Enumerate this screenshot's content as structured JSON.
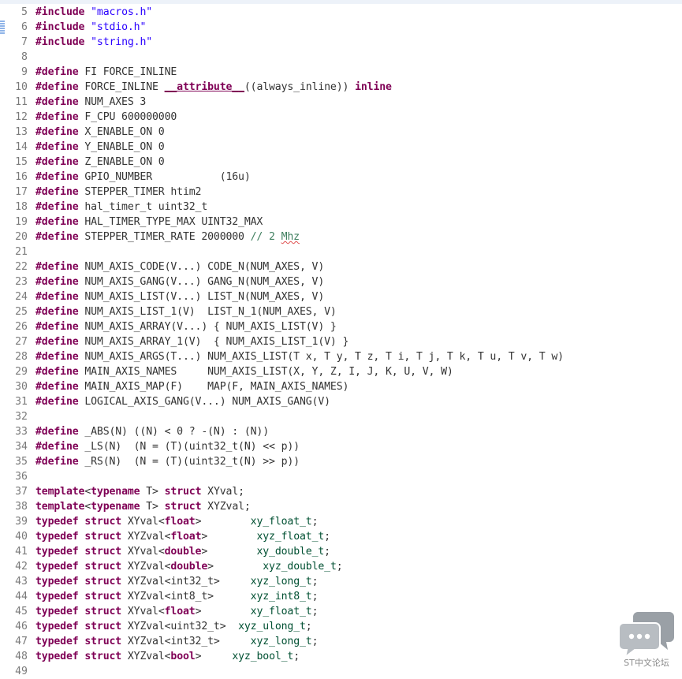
{
  "editor": {
    "lines": [
      {
        "n": "5",
        "tokens": [
          {
            "t": "#include",
            "c": "kw"
          },
          {
            "t": " ",
            "c": ""
          },
          {
            "t": "\"macros.h\"",
            "c": "str"
          }
        ]
      },
      {
        "n": "6",
        "tokens": [
          {
            "t": "#include",
            "c": "kw"
          },
          {
            "t": " ",
            "c": ""
          },
          {
            "t": "\"stdio.h\"",
            "c": "str"
          }
        ]
      },
      {
        "n": "7",
        "tokens": [
          {
            "t": "#include",
            "c": "kw"
          },
          {
            "t": " ",
            "c": ""
          },
          {
            "t": "\"string.h\"",
            "c": "str"
          }
        ]
      },
      {
        "n": "8",
        "tokens": []
      },
      {
        "n": "9",
        "tokens": [
          {
            "t": "#define",
            "c": "kw"
          },
          {
            "t": " FI FORCE_INLINE",
            "c": ""
          }
        ]
      },
      {
        "n": "10",
        "tokens": [
          {
            "t": "#define",
            "c": "kw"
          },
          {
            "t": " FORCE_INLINE ",
            "c": ""
          },
          {
            "t": "__attribute__",
            "c": "tm"
          },
          {
            "t": "((always_inline)) ",
            "c": ""
          },
          {
            "t": "inline",
            "c": "kw"
          }
        ]
      },
      {
        "n": "11",
        "tokens": [
          {
            "t": "#define",
            "c": "kw"
          },
          {
            "t": " NUM_AXES 3",
            "c": ""
          }
        ]
      },
      {
        "n": "12",
        "tokens": [
          {
            "t": "#define",
            "c": "kw"
          },
          {
            "t": " F_CPU 600000000",
            "c": ""
          }
        ]
      },
      {
        "n": "13",
        "tokens": [
          {
            "t": "#define",
            "c": "kw"
          },
          {
            "t": " X_ENABLE_ON 0",
            "c": ""
          }
        ]
      },
      {
        "n": "14",
        "tokens": [
          {
            "t": "#define",
            "c": "kw"
          },
          {
            "t": " Y_ENABLE_ON 0",
            "c": ""
          }
        ]
      },
      {
        "n": "15",
        "tokens": [
          {
            "t": "#define",
            "c": "kw"
          },
          {
            "t": " Z_ENABLE_ON 0",
            "c": ""
          }
        ]
      },
      {
        "n": "16",
        "tokens": [
          {
            "t": "#define",
            "c": "kw"
          },
          {
            "t": " GPIO_NUMBER           (16u)",
            "c": ""
          }
        ]
      },
      {
        "n": "17",
        "tokens": [
          {
            "t": "#define",
            "c": "kw"
          },
          {
            "t": " STEPPER_TIMER htim2",
            "c": ""
          }
        ]
      },
      {
        "n": "18",
        "tokens": [
          {
            "t": "#define",
            "c": "kw"
          },
          {
            "t": " hal_timer_t uint32_t",
            "c": ""
          }
        ]
      },
      {
        "n": "19",
        "tokens": [
          {
            "t": "#define",
            "c": "kw"
          },
          {
            "t": " HAL_TIMER_TYPE_MAX UINT32_MAX",
            "c": ""
          }
        ]
      },
      {
        "n": "20",
        "tokens": [
          {
            "t": "#define",
            "c": "kw"
          },
          {
            "t": " STEPPER_TIMER_RATE 2000000 ",
            "c": ""
          },
          {
            "t": "// 2 ",
            "c": "cm"
          },
          {
            "t": "Mhz",
            "c": "cm sq"
          }
        ]
      },
      {
        "n": "21",
        "tokens": []
      },
      {
        "n": "22",
        "tokens": [
          {
            "t": "#define",
            "c": "kw"
          },
          {
            "t": " NUM_AXIS_CODE(V...) CODE_N(NUM_AXES, V)",
            "c": ""
          }
        ]
      },
      {
        "n": "23",
        "tokens": [
          {
            "t": "#define",
            "c": "kw"
          },
          {
            "t": " NUM_AXIS_GANG(V...) GANG_N(NUM_AXES, V)",
            "c": ""
          }
        ]
      },
      {
        "n": "24",
        "tokens": [
          {
            "t": "#define",
            "c": "kw"
          },
          {
            "t": " NUM_AXIS_LIST(V...) LIST_N(NUM_AXES, V)",
            "c": ""
          }
        ]
      },
      {
        "n": "25",
        "tokens": [
          {
            "t": "#define",
            "c": "kw"
          },
          {
            "t": " NUM_AXIS_LIST_1(V)  LIST_N_1(NUM_AXES, V)",
            "c": ""
          }
        ]
      },
      {
        "n": "26",
        "tokens": [
          {
            "t": "#define",
            "c": "kw"
          },
          {
            "t": " NUM_AXIS_ARRAY(V...) { NUM_AXIS_LIST(V) }",
            "c": ""
          }
        ]
      },
      {
        "n": "27",
        "tokens": [
          {
            "t": "#define",
            "c": "kw"
          },
          {
            "t": " NUM_AXIS_ARRAY_1(V)  { NUM_AXIS_LIST_1(V) }",
            "c": ""
          }
        ]
      },
      {
        "n": "28",
        "tokens": [
          {
            "t": "#define",
            "c": "kw"
          },
          {
            "t": " NUM_AXIS_ARGS(T...) NUM_AXIS_LIST(T x, T y, T z, T i, T j, T k, T u, T v, T w)",
            "c": ""
          }
        ]
      },
      {
        "n": "29",
        "tokens": [
          {
            "t": "#define",
            "c": "kw"
          },
          {
            "t": " MAIN_AXIS_NAMES     NUM_AXIS_LIST(X, Y, Z, I, J, K, U, V, W)",
            "c": ""
          }
        ]
      },
      {
        "n": "30",
        "tokens": [
          {
            "t": "#define",
            "c": "kw"
          },
          {
            "t": " MAIN_AXIS_MAP(F)    MAP(F, MAIN_AXIS_NAMES)",
            "c": ""
          }
        ]
      },
      {
        "n": "31",
        "tokens": [
          {
            "t": "#define",
            "c": "kw"
          },
          {
            "t": " LOGICAL_AXIS_GANG(V...) NUM_AXIS_GANG(V)",
            "c": ""
          }
        ]
      },
      {
        "n": "32",
        "tokens": []
      },
      {
        "n": "33",
        "tokens": [
          {
            "t": "#define",
            "c": "kw"
          },
          {
            "t": " _ABS(N) ((N) < 0 ? -(N) : (N))",
            "c": ""
          }
        ]
      },
      {
        "n": "34",
        "tokens": [
          {
            "t": "#define",
            "c": "kw"
          },
          {
            "t": " _LS(N)  (N = (T)(uint32_t(N) << p))",
            "c": ""
          }
        ]
      },
      {
        "n": "35",
        "tokens": [
          {
            "t": "#define",
            "c": "kw"
          },
          {
            "t": " _RS(N)  (N = (T)(uint32_t(N) >> p))",
            "c": ""
          }
        ]
      },
      {
        "n": "36",
        "tokens": []
      },
      {
        "n": "37",
        "tokens": [
          {
            "t": "template",
            "c": "kw"
          },
          {
            "t": "<",
            "c": ""
          },
          {
            "t": "typename",
            "c": "kw"
          },
          {
            "t": " T> ",
            "c": ""
          },
          {
            "t": "struct",
            "c": "kw"
          },
          {
            "t": " XYval;",
            "c": ""
          }
        ]
      },
      {
        "n": "38",
        "tokens": [
          {
            "t": "template",
            "c": "kw"
          },
          {
            "t": "<",
            "c": ""
          },
          {
            "t": "typename",
            "c": "kw"
          },
          {
            "t": " T> ",
            "c": ""
          },
          {
            "t": "struct",
            "c": "kw"
          },
          {
            "t": " XYZval;",
            "c": ""
          }
        ]
      },
      {
        "n": "39",
        "tokens": [
          {
            "t": "typedef",
            "c": "kw"
          },
          {
            "t": " ",
            "c": ""
          },
          {
            "t": "struct",
            "c": "kw"
          },
          {
            "t": " XYval<",
            "c": ""
          },
          {
            "t": "float",
            "c": "kw"
          },
          {
            "t": ">        ",
            "c": ""
          },
          {
            "t": "xy_float_t",
            "c": "ty"
          },
          {
            "t": ";",
            "c": ""
          }
        ]
      },
      {
        "n": "40",
        "tokens": [
          {
            "t": "typedef",
            "c": "kw"
          },
          {
            "t": " ",
            "c": ""
          },
          {
            "t": "struct",
            "c": "kw"
          },
          {
            "t": " XYZval<",
            "c": ""
          },
          {
            "t": "float",
            "c": "kw"
          },
          {
            "t": ">        ",
            "c": ""
          },
          {
            "t": "xyz_float_t",
            "c": "ty"
          },
          {
            "t": ";",
            "c": ""
          }
        ]
      },
      {
        "n": "41",
        "tokens": [
          {
            "t": "typedef",
            "c": "kw"
          },
          {
            "t": " ",
            "c": ""
          },
          {
            "t": "struct",
            "c": "kw"
          },
          {
            "t": " XYval<",
            "c": ""
          },
          {
            "t": "double",
            "c": "kw"
          },
          {
            "t": ">        ",
            "c": ""
          },
          {
            "t": "xy_double_t",
            "c": "ty"
          },
          {
            "t": ";",
            "c": ""
          }
        ]
      },
      {
        "n": "42",
        "tokens": [
          {
            "t": "typedef",
            "c": "kw"
          },
          {
            "t": " ",
            "c": ""
          },
          {
            "t": "struct",
            "c": "kw"
          },
          {
            "t": " XYZval<",
            "c": ""
          },
          {
            "t": "double",
            "c": "kw"
          },
          {
            "t": ">        ",
            "c": ""
          },
          {
            "t": "xyz_double_t",
            "c": "ty"
          },
          {
            "t": ";",
            "c": ""
          }
        ]
      },
      {
        "n": "43",
        "tokens": [
          {
            "t": "typedef",
            "c": "kw"
          },
          {
            "t": " ",
            "c": ""
          },
          {
            "t": "struct",
            "c": "kw"
          },
          {
            "t": " XYZval<int32_t>     ",
            "c": ""
          },
          {
            "t": "xyz_long_t",
            "c": "ty"
          },
          {
            "t": ";",
            "c": ""
          }
        ]
      },
      {
        "n": "44",
        "tokens": [
          {
            "t": "typedef",
            "c": "kw"
          },
          {
            "t": " ",
            "c": ""
          },
          {
            "t": "struct",
            "c": "kw"
          },
          {
            "t": " XYZval<int8_t>      ",
            "c": ""
          },
          {
            "t": "xyz_int8_t",
            "c": "ty"
          },
          {
            "t": ";",
            "c": ""
          }
        ]
      },
      {
        "n": "45",
        "tokens": [
          {
            "t": "typedef",
            "c": "kw"
          },
          {
            "t": " ",
            "c": ""
          },
          {
            "t": "struct",
            "c": "kw"
          },
          {
            "t": " XYval<",
            "c": ""
          },
          {
            "t": "float",
            "c": "kw"
          },
          {
            "t": ">        ",
            "c": ""
          },
          {
            "t": "xy_float_t",
            "c": "ty"
          },
          {
            "t": ";",
            "c": ""
          }
        ]
      },
      {
        "n": "46",
        "tokens": [
          {
            "t": "typedef",
            "c": "kw"
          },
          {
            "t": " ",
            "c": ""
          },
          {
            "t": "struct",
            "c": "kw"
          },
          {
            "t": " XYZval<uint32_t>  ",
            "c": ""
          },
          {
            "t": "xyz_ulong_t",
            "c": "ty"
          },
          {
            "t": ";",
            "c": ""
          }
        ]
      },
      {
        "n": "47",
        "tokens": [
          {
            "t": "typedef",
            "c": "kw"
          },
          {
            "t": " ",
            "c": ""
          },
          {
            "t": "struct",
            "c": "kw"
          },
          {
            "t": " XYZval<int32_t>     ",
            "c": ""
          },
          {
            "t": "xyz_long_t",
            "c": "ty"
          },
          {
            "t": ";",
            "c": ""
          }
        ]
      },
      {
        "n": "48",
        "tokens": [
          {
            "t": "typedef",
            "c": "kw"
          },
          {
            "t": " ",
            "c": ""
          },
          {
            "t": "struct",
            "c": "kw"
          },
          {
            "t": " XYZval<",
            "c": ""
          },
          {
            "t": "bool",
            "c": "kw"
          },
          {
            "t": ">     ",
            "c": ""
          },
          {
            "t": "xyz_bool_t",
            "c": "ty"
          },
          {
            "t": ";",
            "c": ""
          }
        ]
      },
      {
        "n": "49",
        "tokens": []
      }
    ]
  },
  "watermark": {
    "icon": "chat-bubbles-icon",
    "label": "ST中文论坛",
    "color": "#9aa0a6"
  }
}
